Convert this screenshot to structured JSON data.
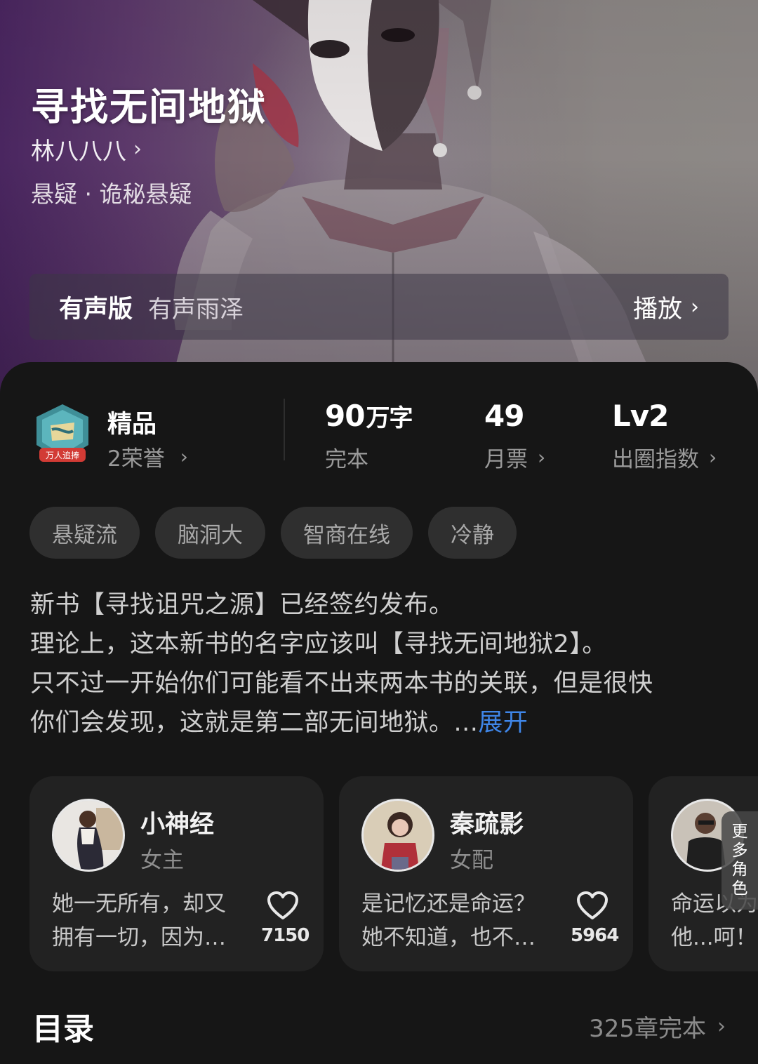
{
  "book": {
    "title": "寻找无间地狱",
    "author": "林八八八",
    "genre": "悬疑 · 诡秘悬疑"
  },
  "audio": {
    "label": "有声版",
    "narrator": "有声雨泽",
    "play_label": "播放"
  },
  "stats": {
    "premium_label": "精品",
    "badge_text": "万人追捧",
    "honor": "2荣誉",
    "words_value": "90",
    "words_unit": "万字",
    "words_label": "完本",
    "tickets_value": "49",
    "tickets_label": "月票",
    "level_value": "Lv2",
    "level_label": "出圈指数"
  },
  "tags": [
    "悬疑流",
    "脑洞大",
    "智商在线",
    "冷静"
  ],
  "synopsis": {
    "lines": [
      "新书【寻找诅咒之源】已经签约发布。",
      "理论上，这本新书的名字应该叫【寻找无间地狱2】。",
      "只不过一开始你们可能看不出来两本书的关联，但是很快",
      "你们会发现，这就是第二部无间地狱。..."
    ],
    "expand_label": "展开"
  },
  "characters": [
    {
      "name": "小神经",
      "role": "女主",
      "desc_1": "她一无所有，却又",
      "desc_2": "拥有一切，因为…",
      "likes": "7150"
    },
    {
      "name": "秦疏影",
      "role": "女配",
      "desc_1": "是记忆还是命运？",
      "desc_2": "她不知道，也不…",
      "likes": "5964"
    },
    {
      "name": "",
      "role": "",
      "desc_1": "命运以为",
      "desc_2": "他...呵！",
      "likes": ""
    }
  ],
  "more_characters": [
    "更",
    "多",
    "角",
    "色"
  ],
  "toc": {
    "title": "目录",
    "meta": "325章完本"
  },
  "colors": {
    "background": "#161616",
    "link": "#3f86e8",
    "tag_bg": "#2f2f2f",
    "card_bg": "#222222"
  }
}
